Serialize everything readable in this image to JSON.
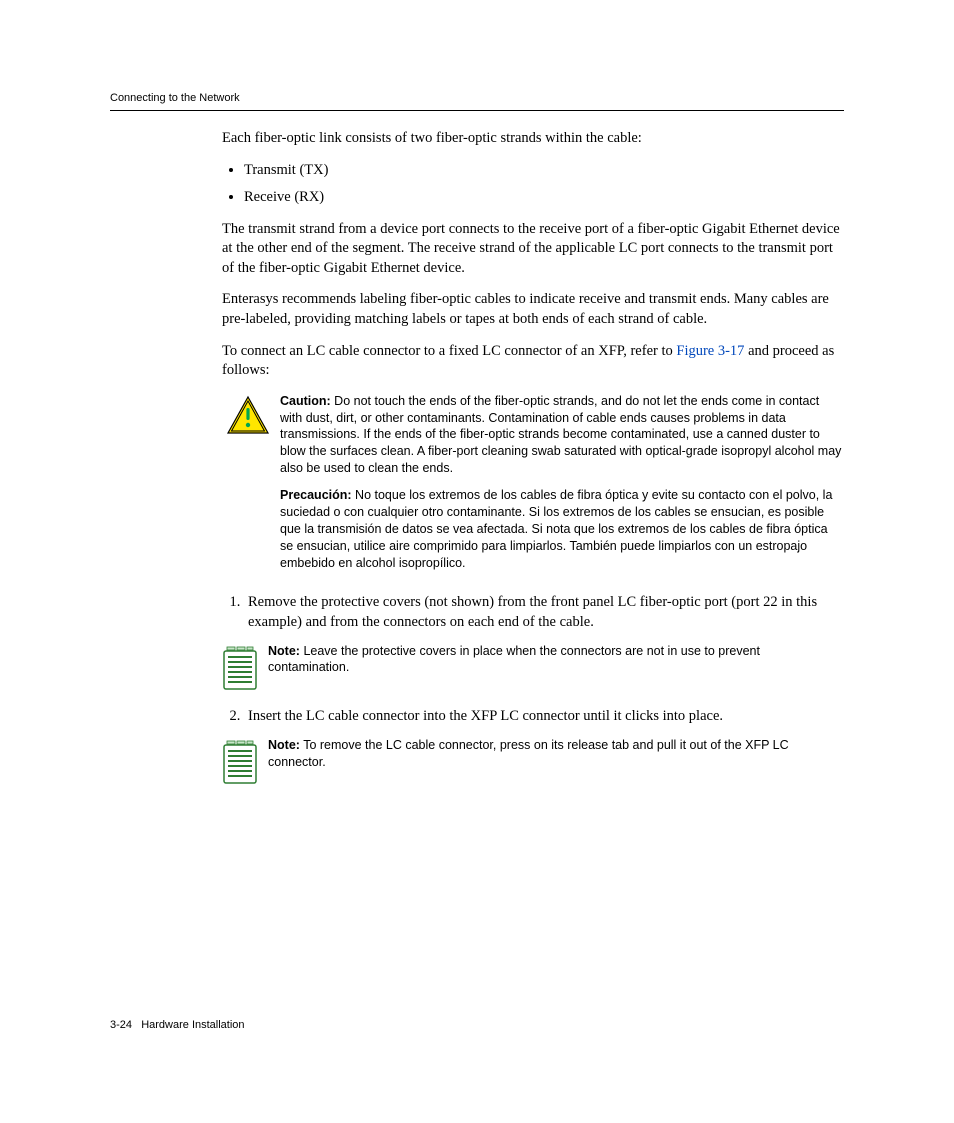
{
  "header": {
    "running_head": "Connecting to the Network"
  },
  "body": {
    "intro": "Each fiber-optic link consists of two fiber-optic strands within the cable:",
    "bullets": [
      "Transmit (TX)",
      "Receive (RX)"
    ],
    "para1": "The transmit strand from a device port connects to the receive port of a fiber-optic Gigabit Ethernet device at the other end of the segment. The receive strand of the applicable LC port connects to the transmit port of the fiber-optic Gigabit Ethernet device.",
    "para2": "Enterasys recommends labeling fiber-optic cables to indicate receive and transmit ends. Many cables are pre-labeled, providing matching labels or tapes at both ends of each strand of cable.",
    "para3_pre": "To connect an LC cable connector to a fixed LC connector of an XFP, refer to ",
    "para3_link": "Figure 3-17",
    "para3_post": " and proceed as follows:",
    "caution": {
      "label": "Caution:",
      "text": "Do not touch the ends of the fiber-optic strands, and do not let the ends come in contact with dust, dirt, or other contaminants. Contamination of cable ends causes problems in data transmissions. If the ends of the fiber-optic strands become contaminated, use a canned duster to blow the surfaces clean. A fiber-port cleaning swab saturated with optical-grade isopropyl alcohol may also be used to clean the ends."
    },
    "precaucion": {
      "label": "Precaución:",
      "text": "No toque los extremos de los cables de fibra óptica y evite su contacto con el polvo, la suciedad o con cualquier otro contaminante. Si los extremos de los cables se ensucian, es posible que la transmisión de datos se vea afectada. Si nota que los extremos de los cables de fibra óptica se ensucian, utilice aire comprimido para limpiarlos. También puede limpiarlos con un estropajo embebido en alcohol isopropílico."
    },
    "steps": [
      {
        "text": "Remove the protective covers (not shown) from the front panel LC fiber-optic port (port 22 in this example) and from the connectors on each end of the cable.",
        "note": {
          "label": "Note:",
          "text": "Leave the protective covers in place when the connectors are not in use to prevent contamination."
        }
      },
      {
        "text": "Insert the LC cable connector into the XFP LC connector until it clicks into place.",
        "note": {
          "label": "Note:",
          "text": "To remove the LC cable connector, press on its release tab and pull it out of the XFP LC connector."
        }
      }
    ]
  },
  "footer": {
    "page": "3-24",
    "chapter": "Hardware Installation"
  }
}
